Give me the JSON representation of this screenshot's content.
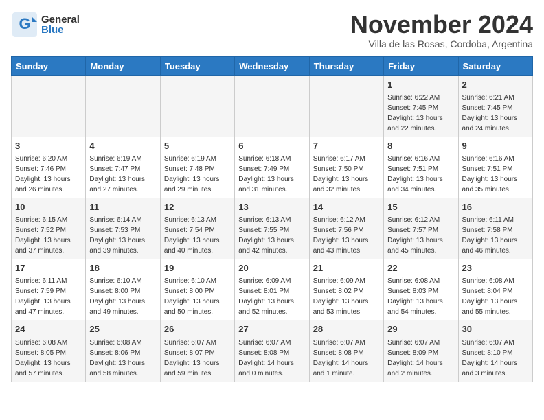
{
  "header": {
    "logo_general": "General",
    "logo_blue": "Blue",
    "title": "November 2024",
    "subtitle": "Villa de las Rosas, Cordoba, Argentina"
  },
  "days_of_week": [
    "Sunday",
    "Monday",
    "Tuesday",
    "Wednesday",
    "Thursday",
    "Friday",
    "Saturday"
  ],
  "weeks": [
    [
      {
        "day": "",
        "info": ""
      },
      {
        "day": "",
        "info": ""
      },
      {
        "day": "",
        "info": ""
      },
      {
        "day": "",
        "info": ""
      },
      {
        "day": "",
        "info": ""
      },
      {
        "day": "1",
        "info": "Sunrise: 6:22 AM\nSunset: 7:45 PM\nDaylight: 13 hours and 22 minutes."
      },
      {
        "day": "2",
        "info": "Sunrise: 6:21 AM\nSunset: 7:45 PM\nDaylight: 13 hours and 24 minutes."
      }
    ],
    [
      {
        "day": "3",
        "info": "Sunrise: 6:20 AM\nSunset: 7:46 PM\nDaylight: 13 hours and 26 minutes."
      },
      {
        "day": "4",
        "info": "Sunrise: 6:19 AM\nSunset: 7:47 PM\nDaylight: 13 hours and 27 minutes."
      },
      {
        "day": "5",
        "info": "Sunrise: 6:19 AM\nSunset: 7:48 PM\nDaylight: 13 hours and 29 minutes."
      },
      {
        "day": "6",
        "info": "Sunrise: 6:18 AM\nSunset: 7:49 PM\nDaylight: 13 hours and 31 minutes."
      },
      {
        "day": "7",
        "info": "Sunrise: 6:17 AM\nSunset: 7:50 PM\nDaylight: 13 hours and 32 minutes."
      },
      {
        "day": "8",
        "info": "Sunrise: 6:16 AM\nSunset: 7:51 PM\nDaylight: 13 hours and 34 minutes."
      },
      {
        "day": "9",
        "info": "Sunrise: 6:16 AM\nSunset: 7:51 PM\nDaylight: 13 hours and 35 minutes."
      }
    ],
    [
      {
        "day": "10",
        "info": "Sunrise: 6:15 AM\nSunset: 7:52 PM\nDaylight: 13 hours and 37 minutes."
      },
      {
        "day": "11",
        "info": "Sunrise: 6:14 AM\nSunset: 7:53 PM\nDaylight: 13 hours and 39 minutes."
      },
      {
        "day": "12",
        "info": "Sunrise: 6:13 AM\nSunset: 7:54 PM\nDaylight: 13 hours and 40 minutes."
      },
      {
        "day": "13",
        "info": "Sunrise: 6:13 AM\nSunset: 7:55 PM\nDaylight: 13 hours and 42 minutes."
      },
      {
        "day": "14",
        "info": "Sunrise: 6:12 AM\nSunset: 7:56 PM\nDaylight: 13 hours and 43 minutes."
      },
      {
        "day": "15",
        "info": "Sunrise: 6:12 AM\nSunset: 7:57 PM\nDaylight: 13 hours and 45 minutes."
      },
      {
        "day": "16",
        "info": "Sunrise: 6:11 AM\nSunset: 7:58 PM\nDaylight: 13 hours and 46 minutes."
      }
    ],
    [
      {
        "day": "17",
        "info": "Sunrise: 6:11 AM\nSunset: 7:59 PM\nDaylight: 13 hours and 47 minutes."
      },
      {
        "day": "18",
        "info": "Sunrise: 6:10 AM\nSunset: 8:00 PM\nDaylight: 13 hours and 49 minutes."
      },
      {
        "day": "19",
        "info": "Sunrise: 6:10 AM\nSunset: 8:00 PM\nDaylight: 13 hours and 50 minutes."
      },
      {
        "day": "20",
        "info": "Sunrise: 6:09 AM\nSunset: 8:01 PM\nDaylight: 13 hours and 52 minutes."
      },
      {
        "day": "21",
        "info": "Sunrise: 6:09 AM\nSunset: 8:02 PM\nDaylight: 13 hours and 53 minutes."
      },
      {
        "day": "22",
        "info": "Sunrise: 6:08 AM\nSunset: 8:03 PM\nDaylight: 13 hours and 54 minutes."
      },
      {
        "day": "23",
        "info": "Sunrise: 6:08 AM\nSunset: 8:04 PM\nDaylight: 13 hours and 55 minutes."
      }
    ],
    [
      {
        "day": "24",
        "info": "Sunrise: 6:08 AM\nSunset: 8:05 PM\nDaylight: 13 hours and 57 minutes."
      },
      {
        "day": "25",
        "info": "Sunrise: 6:08 AM\nSunset: 8:06 PM\nDaylight: 13 hours and 58 minutes."
      },
      {
        "day": "26",
        "info": "Sunrise: 6:07 AM\nSunset: 8:07 PM\nDaylight: 13 hours and 59 minutes."
      },
      {
        "day": "27",
        "info": "Sunrise: 6:07 AM\nSunset: 8:08 PM\nDaylight: 14 hours and 0 minutes."
      },
      {
        "day": "28",
        "info": "Sunrise: 6:07 AM\nSunset: 8:08 PM\nDaylight: 14 hours and 1 minute."
      },
      {
        "day": "29",
        "info": "Sunrise: 6:07 AM\nSunset: 8:09 PM\nDaylight: 14 hours and 2 minutes."
      },
      {
        "day": "30",
        "info": "Sunrise: 6:07 AM\nSunset: 8:10 PM\nDaylight: 14 hours and 3 minutes."
      }
    ]
  ]
}
